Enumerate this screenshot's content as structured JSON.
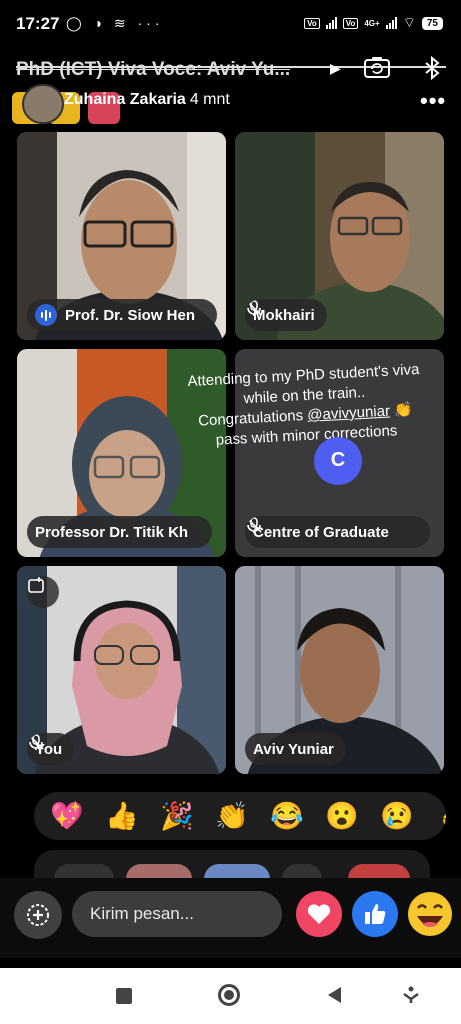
{
  "status_bar": {
    "time": "17:27",
    "battery": "75",
    "network": "4G+"
  },
  "header": {
    "title": "PhD (ICT) Viva Voce: Aviv Yu...",
    "sender": "Zuhaina Zakaria",
    "time": "4 mnt"
  },
  "tiles": [
    {
      "name": "Prof. Dr. Siow Hen",
      "mic": "speaking"
    },
    {
      "name": "Mokhairi",
      "mic": "muted"
    },
    {
      "name": "Professor Dr. Titik Kh",
      "mic": "none"
    },
    {
      "name": "Centre of Graduate",
      "mic": "muted"
    },
    {
      "name": "You",
      "mic": "muted"
    },
    {
      "name": "Aviv Yuniar",
      "mic": "none"
    }
  ],
  "story": {
    "line1": "Attending to my PhD student's viva",
    "line2": "while on the train..",
    "line3_prefix": "Congratulations",
    "mention": "@avivyuniar",
    "line3_emoji": "👏",
    "line4": "pass with minor corrections",
    "loader_letter": "C"
  },
  "reactions": [
    "💖",
    "👍",
    "🎉",
    "👏",
    "😂",
    "😮",
    "😢",
    "👌"
  ],
  "composer": {
    "placeholder": "Kirim pesan..."
  },
  "colors": {
    "accent_blue": "#2b78f0",
    "heart": "#f04565",
    "speaking": "#2f63d8"
  }
}
